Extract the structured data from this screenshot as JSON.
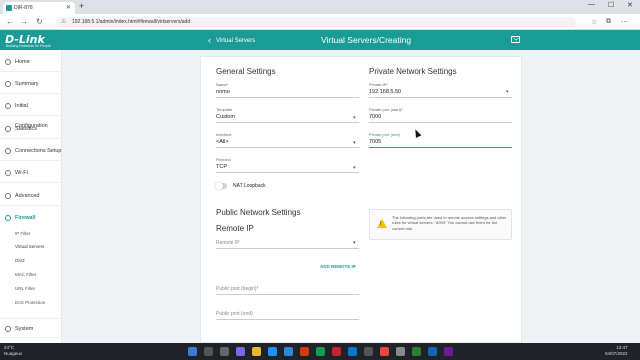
{
  "browser": {
    "tab_title": "DIR-878",
    "url": "192.168.5.1/admin/index.html#firewall/virtservers/add"
  },
  "header": {
    "logo": "D-Link",
    "tagline": "Building Networks for People",
    "back_label": "Virtual Servers",
    "page_title": "Virtual Servers/Creating",
    "brand_color": "#1a9b95"
  },
  "sidebar": {
    "items": [
      {
        "label": "Home",
        "icon": "home-icon"
      },
      {
        "label": "Summary",
        "icon": "info-icon"
      },
      {
        "label": "Initial Configuration",
        "icon": "setup-icon"
      },
      {
        "label": "Statistics",
        "icon": "chart-icon"
      },
      {
        "label": "Connections Setup",
        "icon": "network-icon"
      },
      {
        "label": "Wi-Fi",
        "icon": "wifi-icon"
      },
      {
        "label": "Advanced",
        "icon": "gear-icon"
      },
      {
        "label": "Firewall",
        "icon": "shield-icon"
      },
      {
        "label": "System",
        "icon": "system-icon"
      }
    ],
    "firewall_sub": [
      "IP Filter",
      "Virtual Servers",
      "DMZ",
      "MAC Filter",
      "URL Filter",
      "DoS Protection"
    ]
  },
  "general": {
    "title": "General Settings",
    "name_label": "Name*",
    "name_value": "nomo",
    "template_label": "Template",
    "template_value": "Custom",
    "interface_label": "Interface",
    "interface_value": "<All>",
    "protocol_label": "Protocol",
    "protocol_value": "TCP",
    "nat_loopback_label": "NAT Loopback",
    "nat_loopback_on": false
  },
  "private": {
    "title": "Private Network Settings",
    "ip_label": "Private IP*",
    "ip_value": "192.168.5.50",
    "port_start_label": "Private port (start)*",
    "port_start_value": "7000",
    "port_end_label": "Private port (end)",
    "port_end_value": "7005"
  },
  "public": {
    "title": "Public Network Settings",
    "remote_ip_title": "Remote IP",
    "remote_ip_placeholder": "Remote IP",
    "add_remote_ip": "ADD REMOTE IP",
    "port_begin_placeholder": "Public port (begin)*",
    "port_end_placeholder": "Public port (end)"
  },
  "notice": {
    "text": "The following ports are used in remote access settings and other rules for virtual servers: \"8999\" You cannot use them for the current rule."
  },
  "taskbar": {
    "temp": "24°C",
    "weather": "Nuageux",
    "time": "13:47",
    "date": "04/07/2022"
  }
}
